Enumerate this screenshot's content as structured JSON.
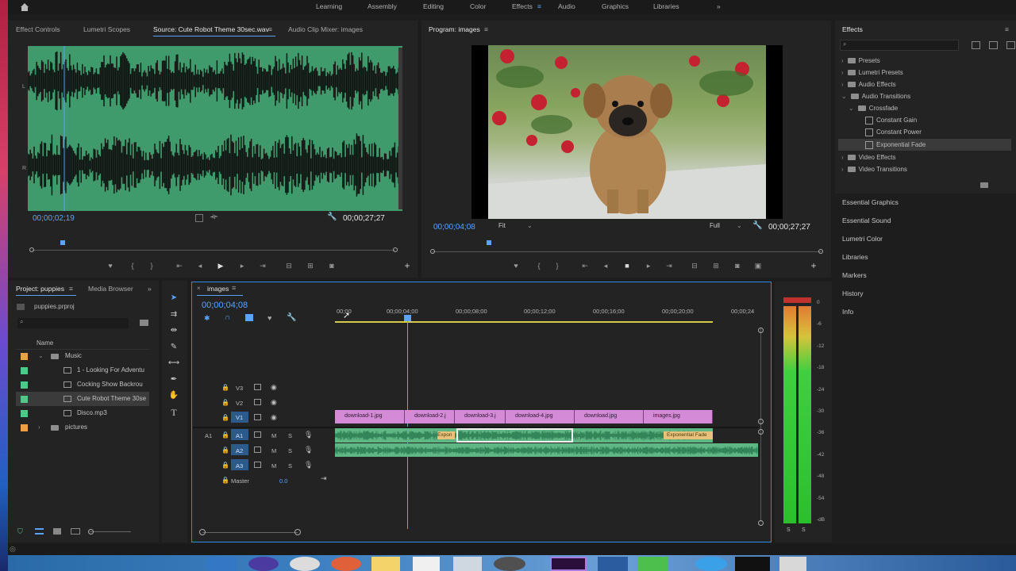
{
  "workspaces": {
    "home_icon": "home-icon",
    "tabs": [
      "Learning",
      "Assembly",
      "Editing",
      "Color",
      "Effects",
      "Audio",
      "Graphics",
      "Libraries"
    ],
    "active": "Effects",
    "more": "»"
  },
  "source_panel": {
    "tabs": [
      "Effect Controls",
      "Lumetri Scopes",
      "Source: Cute Robot Theme 30sec.wav",
      "Audio Clip Mixer: images"
    ],
    "channel_left": "L",
    "channel_right": "R",
    "timecode_current": "00;00;02;19",
    "timecode_duration": "00;00;27;27"
  },
  "program_panel": {
    "title": "Program: images",
    "timecode_current": "00;00;04;08",
    "fit": "Fit",
    "quality": "Full",
    "timecode_duration": "00;00;27;27"
  },
  "effects_panel": {
    "title": "Effects",
    "search_placeholder": "",
    "tree": [
      {
        "label": "Presets"
      },
      {
        "label": "Lumetri Presets"
      },
      {
        "label": "Audio Effects"
      },
      {
        "label": "Audio Transitions"
      },
      {
        "label": "Crossfade"
      },
      {
        "label": "Constant Gain"
      },
      {
        "label": "Constant Power"
      },
      {
        "label": "Exponential Fade"
      },
      {
        "label": "Video Effects"
      },
      {
        "label": "Video Transitions"
      }
    ],
    "sections": [
      "Essential Graphics",
      "Essential Sound",
      "Lumetri Color",
      "Libraries",
      "Markers",
      "History",
      "Info"
    ]
  },
  "project_panel": {
    "tabs": [
      "Project: puppies",
      "Media Browser"
    ],
    "more": "»",
    "file": "puppies.prproj",
    "column_name": "Name",
    "items": [
      {
        "label": "Music",
        "color": "#e8a04a"
      },
      {
        "label": "1 - Looking For Adventu",
        "color": "#4fc98a"
      },
      {
        "label": "Cocking Show Backrou",
        "color": "#4fc98a"
      },
      {
        "label": "Cute Robot Theme 30se",
        "color": "#4fc98a"
      },
      {
        "label": "Disco.mp3",
        "color": "#4fc98a"
      },
      {
        "label": "pictures",
        "color": "#e8a04a"
      }
    ]
  },
  "timeline": {
    "title": "images",
    "timecode": "00;00;04;08",
    "ruler": [
      "00;00",
      "00;00;04;00",
      "00;00;08;00",
      "00;00;12;00",
      "00;00;16;00",
      "00;00;20;00",
      "00;00;24"
    ],
    "tracks": {
      "video": [
        "V3",
        "V2",
        "V1"
      ],
      "audio": [
        "A1",
        "A2",
        "A3"
      ],
      "source_patch": "A1",
      "mute": "M",
      "solo": "S",
      "master": "Master",
      "master_value": "0.0"
    },
    "video_clips": [
      "download-1.jpg",
      "download-2.j",
      "download-3.j",
      "download-4.jpg",
      "download.jpg",
      "images.jpg"
    ],
    "audio_transitions": [
      "Expon",
      "Exponential Fade"
    ]
  },
  "meter": {
    "scale": [
      "0",
      "-6",
      "-12",
      "-18",
      "-24",
      "-30",
      "-36",
      "-42",
      "-48",
      "-54",
      "-dB"
    ],
    "solo_labels": [
      "S",
      "S"
    ]
  },
  "colors": {
    "accent": "#2d8ceb",
    "audio_waveform_bg": "#3f9a6c",
    "video_clip": "#d58ad8",
    "audio_clip": "#5fb884"
  }
}
